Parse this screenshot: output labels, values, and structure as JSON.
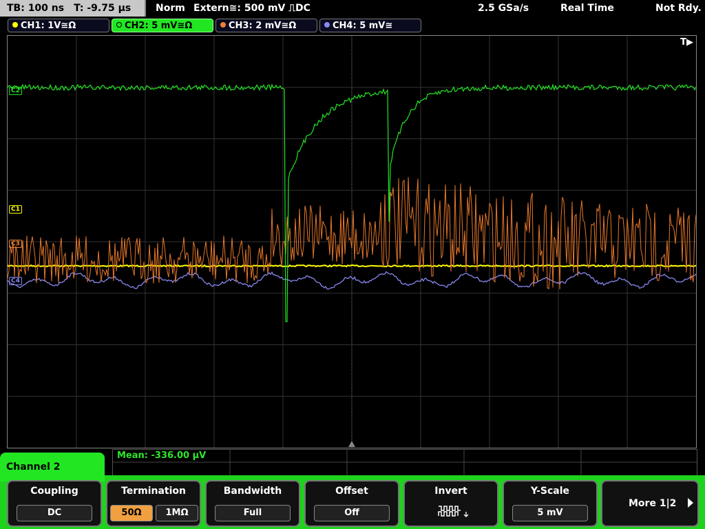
{
  "status": {
    "timebase": "TB: 100 ns",
    "trigger_time": "T: -9.75 µs",
    "mode": "Norm",
    "trigger_source": "Extern≅: 500 mV ⎍DC",
    "sample_rate": "2.5 GSa/s",
    "acq_mode": "Real Time",
    "state": "Not Rdy."
  },
  "channels": [
    {
      "label": "CH1: 1V≅Ω",
      "color": "#ffff00"
    },
    {
      "label": "CH2: 5 mV≅Ω",
      "color": "#22e622"
    },
    {
      "label": "CH3: 2 mV≅Ω",
      "color": "#f08030"
    },
    {
      "label": "CH4: 5 mV≅",
      "color": "#8888ee"
    }
  ],
  "markers": {
    "trigger": "T▶",
    "c1": "C1",
    "c2": "C2",
    "c3": "C3",
    "c4": "C4"
  },
  "measurement": {
    "mean": "Mean: -336.00 µV"
  },
  "active_channel": "Channel 2",
  "softkeys": {
    "coupling": {
      "title": "Coupling",
      "value": "DC"
    },
    "termination": {
      "title": "Termination",
      "opt1": "50Ω",
      "opt2": "1MΩ"
    },
    "bandwidth": {
      "title": "Bandwidth",
      "value": "Full"
    },
    "offset": {
      "title": "Offset",
      "value": "Off"
    },
    "invert": {
      "title": "Invert",
      "icon": "invert-wave-icon"
    },
    "yscale": {
      "title": "Y-Scale",
      "value": "5 mV"
    },
    "more": {
      "label": "More 1|2",
      "icon": "arrow-right-icon"
    }
  }
}
